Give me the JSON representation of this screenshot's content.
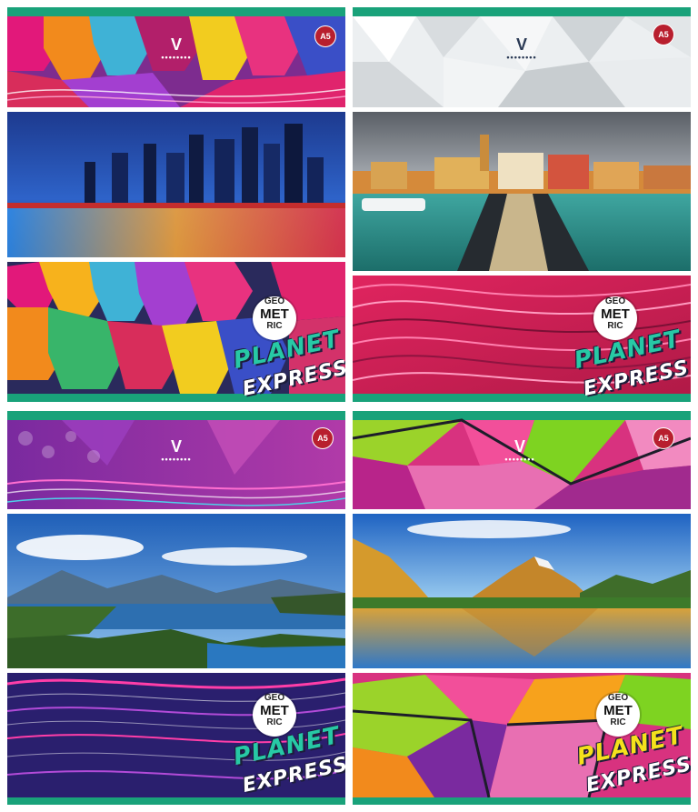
{
  "brand": {
    "line1": "GEO",
    "line2": "MET",
    "line3": "RIC",
    "word1": "PLANET",
    "word2": "EXPRESS"
  },
  "badge_text": "A5",
  "logo": {
    "mark": "V",
    "dots": "••••••••"
  },
  "covers": [
    {
      "id": "city-night",
      "photo": "city-skyline-night",
      "pattern": "hexagons",
      "word1_color": "#27c9a5"
    },
    {
      "id": "harbor",
      "photo": "harbor-old-town",
      "pattern": "waves",
      "word1_color": "#27c9a5"
    },
    {
      "id": "lake-forest",
      "photo": "lake-forest-mountains",
      "pattern": "purple-waves",
      "word1_color": "#27c9a5"
    },
    {
      "id": "mountain-lake",
      "photo": "mountain-lake-reflection",
      "pattern": "green-polygons",
      "word1_color": "#f4e11c"
    }
  ]
}
